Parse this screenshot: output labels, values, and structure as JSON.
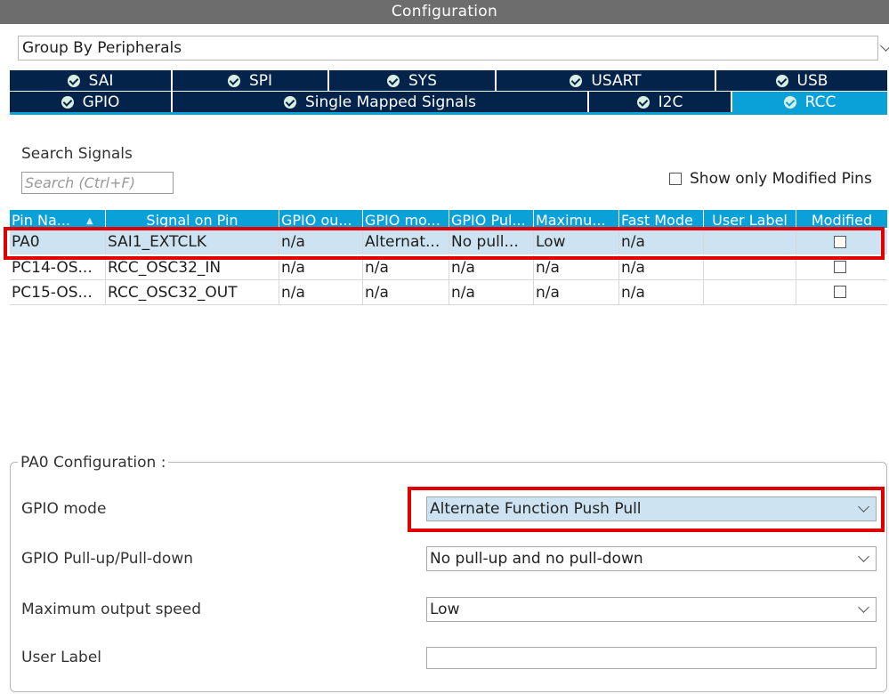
{
  "window": {
    "title": "Configuration"
  },
  "group_by": {
    "value": "Group By Peripherals"
  },
  "tabs": {
    "row1": [
      "SAI",
      "SPI",
      "SYS",
      "USART",
      "USB"
    ],
    "row2": [
      "GPIO",
      "Single Mapped Signals",
      "I2C",
      "RCC"
    ],
    "active": "RCC"
  },
  "search": {
    "label": "Search Signals",
    "placeholder": "Search (Ctrl+F)"
  },
  "show_modified": {
    "label": "Show only Modified Pins",
    "checked": false
  },
  "table": {
    "headers": [
      "Pin Na...",
      "Signal on Pin",
      "GPIO ou...",
      "GPIO mo...",
      "GPIO Pul...",
      "Maximu...",
      "Fast Mode",
      "User Label",
      "Modified"
    ],
    "sort_column": "Pin Na...",
    "rows": [
      {
        "pin": "PA0",
        "signal": "SAI1_EXTCLK",
        "gpio_output": "n/a",
        "gpio_mode": "Alternat...",
        "gpio_pull": "No pull...",
        "max_speed": "Low",
        "fast_mode": "n/a",
        "user_label": "",
        "modified": false,
        "selected": true
      },
      {
        "pin": "PC14-OS...",
        "signal": "RCC_OSC32_IN",
        "gpio_output": "n/a",
        "gpio_mode": "n/a",
        "gpio_pull": "n/a",
        "max_speed": "n/a",
        "fast_mode": "n/a",
        "user_label": "",
        "modified": false,
        "selected": false
      },
      {
        "pin": "PC15-OS...",
        "signal": "RCC_OSC32_OUT",
        "gpio_output": "n/a",
        "gpio_mode": "n/a",
        "gpio_pull": "n/a",
        "max_speed": "n/a",
        "fast_mode": "n/a",
        "user_label": "",
        "modified": false,
        "selected": false
      }
    ]
  },
  "pin_config": {
    "title": "PA0 Configuration :",
    "fields": [
      {
        "label": "GPIO mode",
        "value": "Alternate Function Push Pull"
      },
      {
        "label": "GPIO Pull-up/Pull-down",
        "value": "No pull-up and no pull-down"
      },
      {
        "label": "Maximum output speed",
        "value": "Low"
      },
      {
        "label": "User Label",
        "value": ""
      }
    ]
  },
  "colors": {
    "tab_bg": "#03234b",
    "tab_active": "#0aa1d9",
    "highlight": "#e00000",
    "selection": "#cde3f1"
  }
}
